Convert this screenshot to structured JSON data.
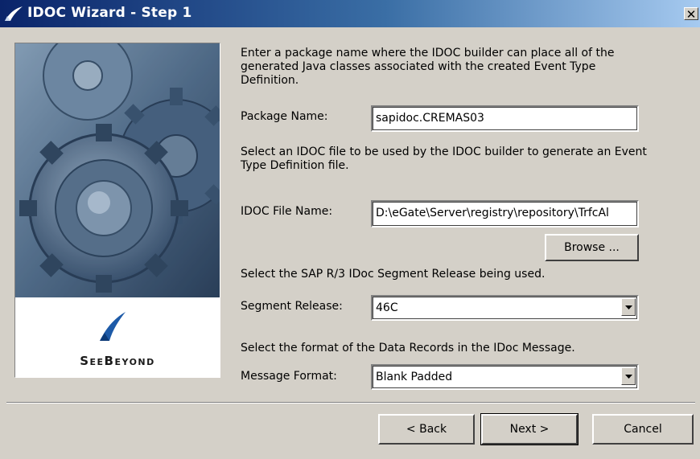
{
  "window": {
    "title": "IDOC Wizard - Step 1",
    "close_glyph": "✕"
  },
  "branding": {
    "logo_text": "SeeBeyond",
    "logo_icon": "seebeyond-swoosh-icon"
  },
  "intro": {
    "package_instructions": "Enter a package name where the IDOC builder can place all of the generated Java classes associated with the created Event Type Definition.",
    "idoc_file_instructions": "Select an IDOC file to be used by the IDOC builder to generate an Event Type Definition file.",
    "segment_instructions": "Select the SAP R/3 IDoc Segment Release being used.",
    "format_instructions": "Select the format of the Data Records in the IDoc Message."
  },
  "fields": {
    "package_label": "Package Name:",
    "package_value": "sapidoc.CREMAS03",
    "idoc_file_label": "IDOC File Name:",
    "idoc_file_value": "D:\\eGate\\Server\\registry\\repository\\TrfcAl",
    "browse_label": "Browse ...",
    "segment_label": "Segment Release:",
    "segment_value": "46C",
    "message_format_label": "Message Format:",
    "message_format_value": "Blank Padded"
  },
  "buttons": {
    "back_label": "< Back",
    "next_label": "Next >",
    "cancel_label": "Cancel"
  },
  "colors": {
    "titlebar_start": "#0a246a",
    "titlebar_end": "#a6caf0",
    "dialog_bg": "#d4d0c8",
    "logo_blue": "#1d5aa8"
  }
}
